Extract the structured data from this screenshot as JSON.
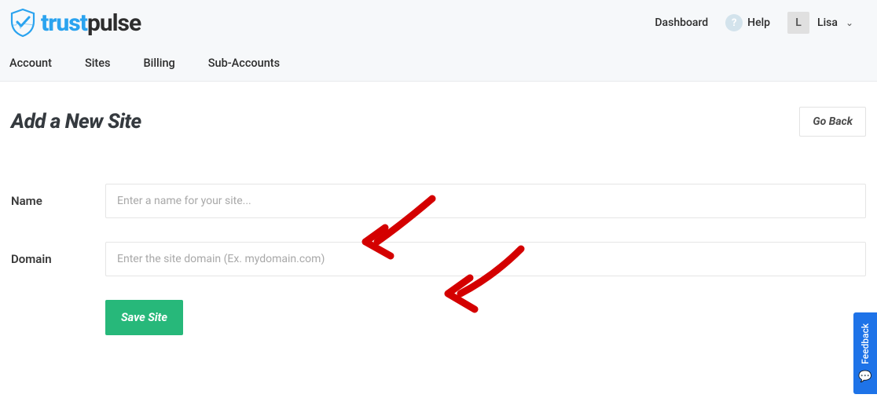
{
  "brand": {
    "part1": "trust",
    "part2": "pulse"
  },
  "header": {
    "dashboard": "Dashboard",
    "help": "Help",
    "help_icon": "?",
    "user_initial": "L",
    "user_name": "Lisa"
  },
  "nav": {
    "account": "Account",
    "sites": "Sites",
    "billing": "Billing",
    "subaccounts": "Sub-Accounts"
  },
  "page": {
    "title": "Add a New Site",
    "go_back": "Go Back"
  },
  "form": {
    "name_label": "Name",
    "name_placeholder": "Enter a name for your site...",
    "domain_label": "Domain",
    "domain_placeholder": "Enter the site domain (Ex. mydomain.com)",
    "save_button": "Save Site"
  },
  "feedback": {
    "label": "Feedback"
  }
}
